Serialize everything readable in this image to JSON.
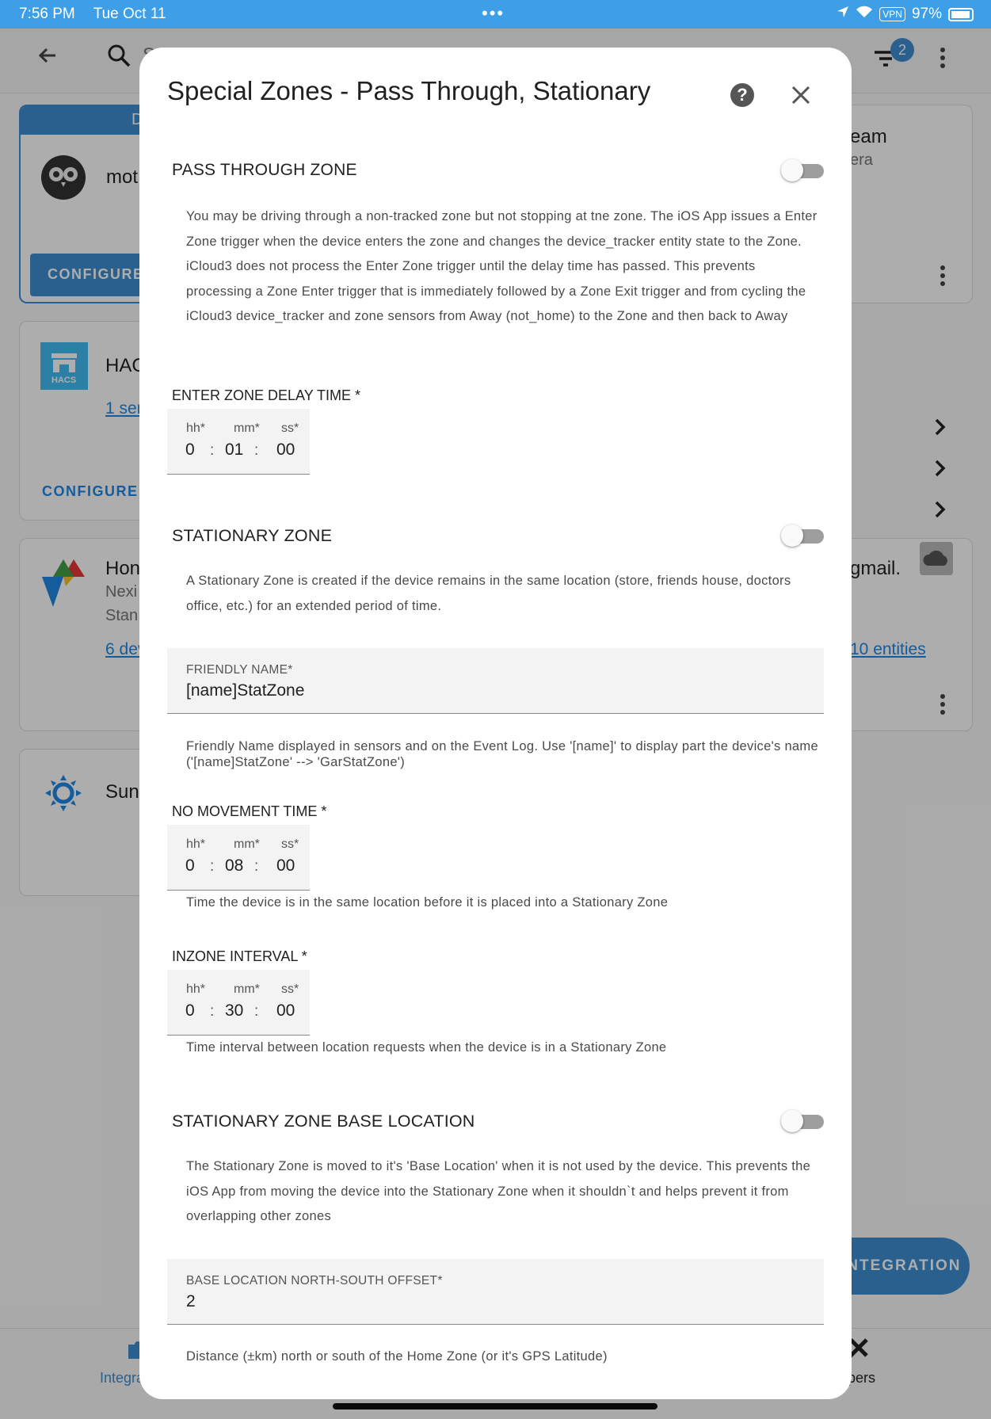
{
  "status_bar": {
    "time": "7:56 PM",
    "date": "Tue Oct 11",
    "dots": "•••",
    "vpn": "VPN",
    "battery": "97%"
  },
  "header": {
    "search_fragment": "S",
    "filter_count": "2"
  },
  "background": {
    "card1_tab_fragment": "D",
    "card1_name": "mot",
    "card1_configure": "CONFIGURE",
    "card2_name": "HAC",
    "card2_link": "1 ser",
    "card2_configure": "CONFIGURE",
    "hacs_logo": "HACS",
    "card3_name": "Hon",
    "card3_sub1": "Nexi",
    "card3_sub2": "Stan",
    "card3_link": "6 dev",
    "card4_name": "Sun",
    "right_card1_title": "eam",
    "right_card1_sub": "era",
    "right_card2_title": "gmail.",
    "right_card2_link": "10 entities",
    "fab_label": "INTEGRATION",
    "nav_left": "Integra",
    "nav_right": "pers"
  },
  "dialog": {
    "title": "Special Zones - Pass Through, Stationary",
    "pass_through": {
      "title": "PASS THROUGH ZONE",
      "description": "You may be driving through a non-tracked zone but not stopping at tne zone. The iOS App issues a Enter Zone trigger when the device enters the zone and changes the device_tracker entity state to the Zone. iCloud3 does not process the Enter Zone trigger until the delay time has passed. This prevents processing a Zone Enter trigger that is immediately followed by a Zone Exit trigger and from cycling the iCloud3 device_tracker and zone sensors from Away (not_home) to the Zone and then back to Away",
      "delay_label": "ENTER ZONE DELAY TIME *",
      "delay": {
        "hh": "0",
        "mm": "01",
        "ss": "00"
      }
    },
    "time_labels": {
      "hh": "hh*",
      "mm": "mm*",
      "ss": "ss*",
      "sep": ":"
    },
    "stationary": {
      "title": "STATIONARY ZONE",
      "description": "A Stationary Zone is created if the device remains in the same location (store, friends house, doctors office, etc.) for an extended period of time.",
      "friendly_name_label": "FRIENDLY NAME*",
      "friendly_name_value": "[name]StatZone",
      "friendly_name_helper": "Friendly Name displayed in sensors and on the Event Log. Use '[name]' to display part the device's name ('[name]StatZone' --> 'GarStatZone')",
      "no_movement_label": "NO MOVEMENT TIME *",
      "no_movement": {
        "hh": "0",
        "mm": "08",
        "ss": "00"
      },
      "no_movement_helper": "Time the device is in the same location before it is placed into a Stationary Zone",
      "inzone_label": "INZONE INTERVAL *",
      "inzone": {
        "hh": "0",
        "mm": "30",
        "ss": "00"
      },
      "inzone_helper": "Time interval between location requests when the device is in a Stationary Zone"
    },
    "base_location": {
      "title": "STATIONARY ZONE BASE LOCATION",
      "description": "The Stationary Zone is moved to it's 'Base Location' when it is not used by the device. This prevents the iOS App from moving the device into the Stationary Zone when it shouldn`t and helps prevent it from overlapping other zones",
      "ns_offset_label": "BASE LOCATION NORTH-SOUTH OFFSET*",
      "ns_offset_value": "2",
      "ns_offset_helper": "Distance (±km) north or south of the Home Zone (or it's GPS Latitude)"
    }
  }
}
